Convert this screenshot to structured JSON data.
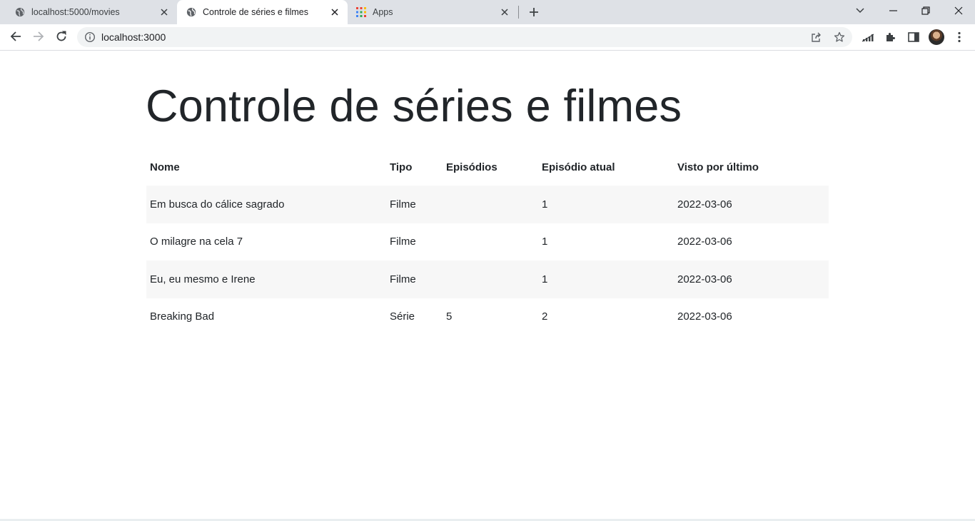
{
  "browser": {
    "tabs": [
      {
        "title": "localhost:5000/movies",
        "icon": "globe-icon",
        "active": false
      },
      {
        "title": "Controle de séries e filmes",
        "icon": "globe-icon",
        "active": true
      },
      {
        "title": "Apps",
        "icon": "apps-grid-icon",
        "active": false
      }
    ],
    "address": "localhost:3000"
  },
  "page": {
    "title": "Controle de séries e filmes",
    "table": {
      "headers": [
        "Nome",
        "Tipo",
        "Episódios",
        "Episódio atual",
        "Visto por último"
      ],
      "rows": [
        [
          "Em busca do cálice sagrado",
          "Filme",
          "",
          "1",
          "2022-03-06"
        ],
        [
          "O milagre na cela 7",
          "Filme",
          "",
          "1",
          "2022-03-06"
        ],
        [
          "Eu, eu mesmo e Irene",
          "Filme",
          "",
          "1",
          "2022-03-06"
        ],
        [
          "Breaking Bad",
          "Série",
          "5",
          "2",
          "2022-03-06"
        ]
      ]
    }
  }
}
